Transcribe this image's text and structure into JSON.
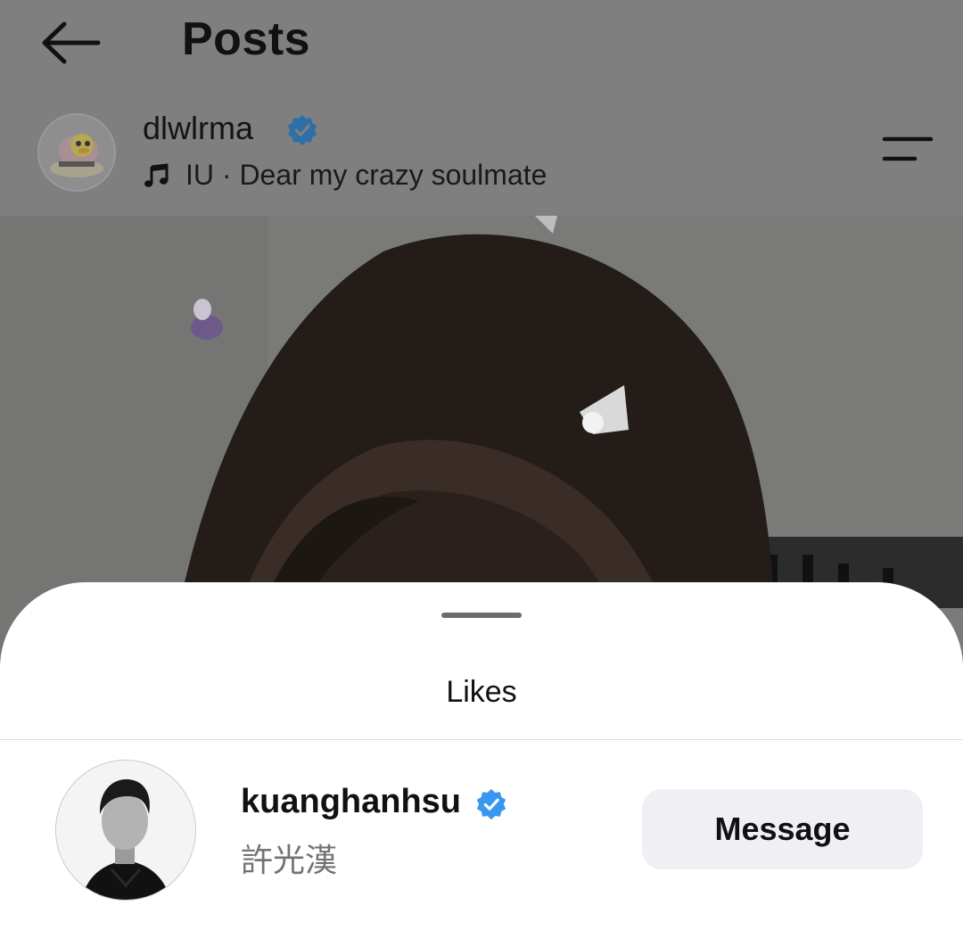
{
  "header": {
    "title": "Posts",
    "back_icon": "arrow-left-icon"
  },
  "post": {
    "username": "dlwlrma",
    "verified": true,
    "music": "IU · Dear my crazy soulmate",
    "music_icon": "music-note-icon",
    "menu_icon": "menu-icon"
  },
  "likes_sheet": {
    "title": "Likes",
    "likers": [
      {
        "username": "kuanghanhsu",
        "full_name": "許光漢",
        "verified": true,
        "action_label": "Message"
      }
    ]
  },
  "colors": {
    "verified_blue": "#3897f0",
    "dim_overlay": "#808080",
    "sheet_bg": "#ffffff",
    "button_bg": "#efeff4"
  }
}
